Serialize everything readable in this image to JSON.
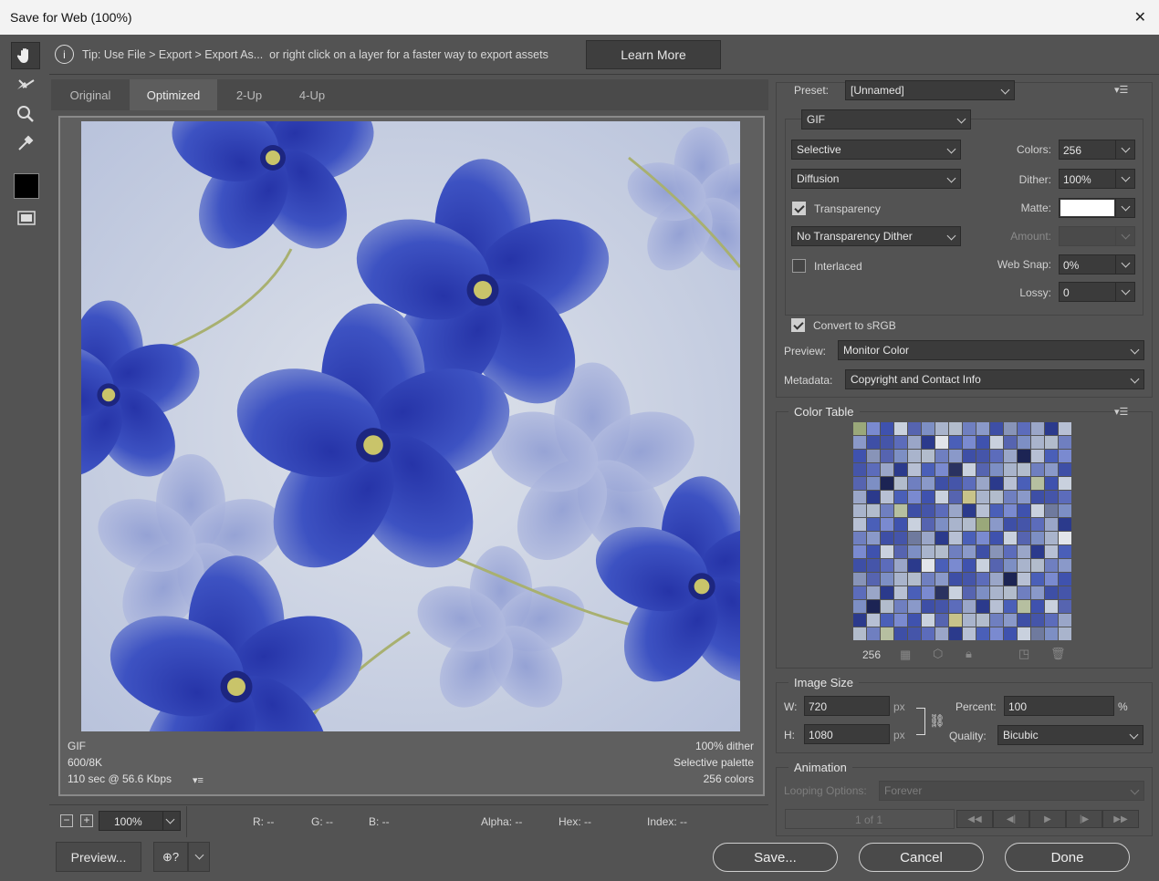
{
  "window": {
    "title": "Save for Web (100%)"
  },
  "tip": {
    "text": "Tip: Use File > Export > Export As...  or right click on a layer for a faster way to export assets",
    "learn_more": "Learn More"
  },
  "tabs": [
    "Original",
    "Optimized",
    "2-Up",
    "4-Up"
  ],
  "active_tab": "Optimized",
  "image_info": {
    "left": [
      "GIF",
      "600/8K",
      "110 sec @ 56.6 Kbps"
    ],
    "right": [
      "100% dither",
      "Selective palette",
      "256 colors"
    ]
  },
  "bottom": {
    "zoom": "100%",
    "r": "R: --",
    "g": "G: --",
    "b": "B: --",
    "alpha": "Alpha: --",
    "hex": "Hex: --",
    "index": "Index: --"
  },
  "buttons": {
    "preview": "Preview...",
    "save": "Save...",
    "cancel": "Cancel",
    "done": "Done"
  },
  "settings": {
    "preset_label": "Preset:",
    "preset_value": "[Unnamed]",
    "format": "GIF",
    "reduction": "Selective",
    "dither_algo": "Diffusion",
    "transparency_label": "Transparency",
    "transparency_checked": true,
    "trans_dither": "No Transparency Dither",
    "interlaced_label": "Interlaced",
    "interlaced_checked": false,
    "colors_label": "Colors:",
    "colors_value": "256",
    "dither_label": "Dither:",
    "dither_value": "100%",
    "matte_label": "Matte:",
    "amount_label": "Amount:",
    "websnap_label": "Web Snap:",
    "websnap_value": "0%",
    "lossy_label": "Lossy:",
    "lossy_value": "0",
    "srgb_label": "Convert to sRGB",
    "srgb_checked": true,
    "preview_label": "Preview:",
    "preview_value": "Monitor Color",
    "metadata_label": "Metadata:",
    "metadata_value": "Copyright and Contact Info"
  },
  "color_table": {
    "title": "Color Table",
    "count": "256",
    "colors": [
      "#4a5fb8",
      "#7d8fc4",
      "#3e4fa6",
      "#b7c0d4",
      "#5664b0",
      "#8a99c9",
      "#2b3a8c",
      "#c9d1de",
      "#6f7fc0",
      "#9aa6c8",
      "#3f52ae",
      "#b2bccc",
      "#5c6cbb",
      "#7a8ad0",
      "#a9b4cc",
      "#4555a9"
    ]
  },
  "image_size": {
    "title": "Image Size",
    "w_label": "W:",
    "w_value": "720",
    "h_label": "H:",
    "h_value": "1080",
    "unit": "px",
    "percent_label": "Percent:",
    "percent_value": "100",
    "percent_unit": "%",
    "quality_label": "Quality:",
    "quality_value": "Bicubic"
  },
  "animation": {
    "title": "Animation",
    "looping_label": "Looping Options:",
    "looping_value": "Forever",
    "frame": "1 of 1"
  }
}
